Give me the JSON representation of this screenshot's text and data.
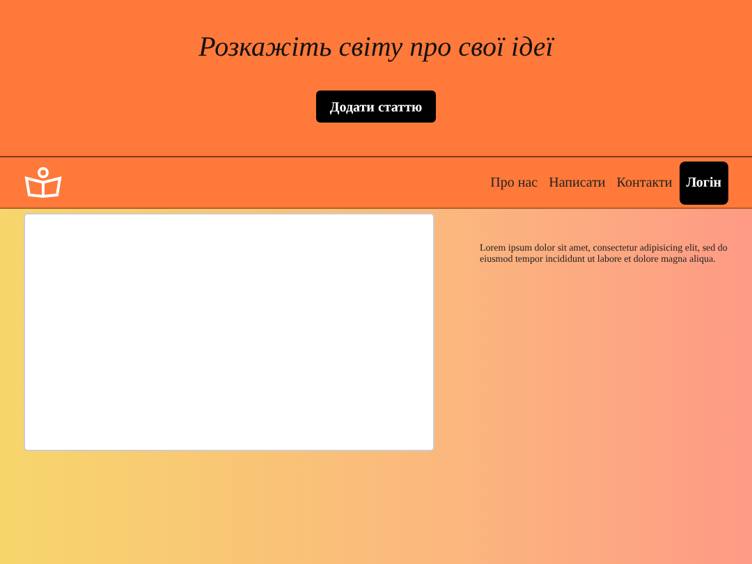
{
  "hero": {
    "title": "Розкажіть світу про свої ідеї",
    "button": "Додати статтю"
  },
  "nav": {
    "links": [
      {
        "label": "Про нас",
        "kind": "link"
      },
      {
        "label": "Написати",
        "kind": "link"
      },
      {
        "label": "Контакти",
        "kind": "link"
      },
      {
        "label": "Логін",
        "kind": "button"
      }
    ]
  },
  "content": {
    "text": "Lorem ipsum dolor sit amet, consectetur adipisicing elit, sed do eiusmod tempor incididunt ut labore et dolore magna aliqua."
  }
}
